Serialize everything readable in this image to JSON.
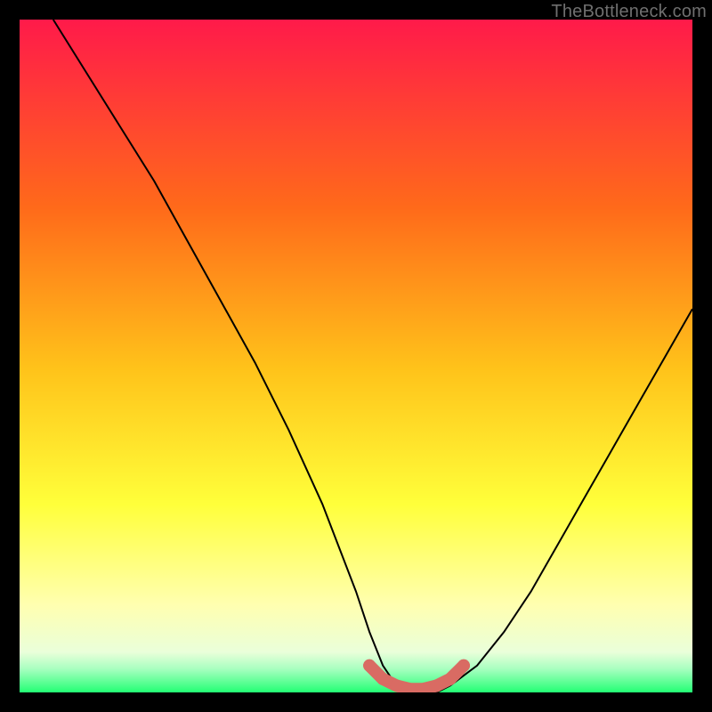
{
  "attribution": "TheBottleneck.com",
  "colors": {
    "border": "#000000",
    "gradient_top": "#ff1a4a",
    "gradient_mid_upper": "#ff7a1a",
    "gradient_mid": "#ffd21a",
    "gradient_lower": "#ffff6a",
    "gradient_pale": "#ffffe0",
    "gradient_green": "#2aff7a",
    "curve": "#000000",
    "marker": "#d96b63"
  },
  "chart_data": {
    "type": "line",
    "title": "",
    "xlabel": "",
    "ylabel": "",
    "xlim": [
      0,
      100
    ],
    "ylim": [
      0,
      100
    ],
    "grid": false,
    "legend": false,
    "series": [
      {
        "name": "bottleneck-curve",
        "x": [
          5,
          10,
          15,
          20,
          25,
          30,
          35,
          40,
          45,
          50,
          52,
          54,
          56,
          58,
          60,
          62,
          64,
          68,
          72,
          76,
          80,
          84,
          88,
          92,
          96,
          100
        ],
        "y": [
          100,
          92,
          84,
          76,
          67,
          58,
          49,
          39,
          28,
          15,
          9,
          4,
          1,
          0,
          0,
          0,
          1,
          4,
          9,
          15,
          22,
          29,
          36,
          43,
          50,
          57
        ]
      }
    ],
    "markers": {
      "name": "valley-highlight",
      "x": [
        52,
        54,
        56,
        58,
        60,
        62,
        64,
        66
      ],
      "y": [
        4,
        2,
        1,
        0.5,
        0.5,
        1,
        2,
        4
      ]
    },
    "gradient_stops": [
      {
        "pos": 0.0,
        "color": "#ff1a4a"
      },
      {
        "pos": 0.28,
        "color": "#ff6a1a"
      },
      {
        "pos": 0.52,
        "color": "#ffc31a"
      },
      {
        "pos": 0.72,
        "color": "#ffff3a"
      },
      {
        "pos": 0.87,
        "color": "#ffffb0"
      },
      {
        "pos": 0.94,
        "color": "#eaffda"
      },
      {
        "pos": 0.965,
        "color": "#a8ffc0"
      },
      {
        "pos": 1.0,
        "color": "#23ff74"
      }
    ]
  }
}
